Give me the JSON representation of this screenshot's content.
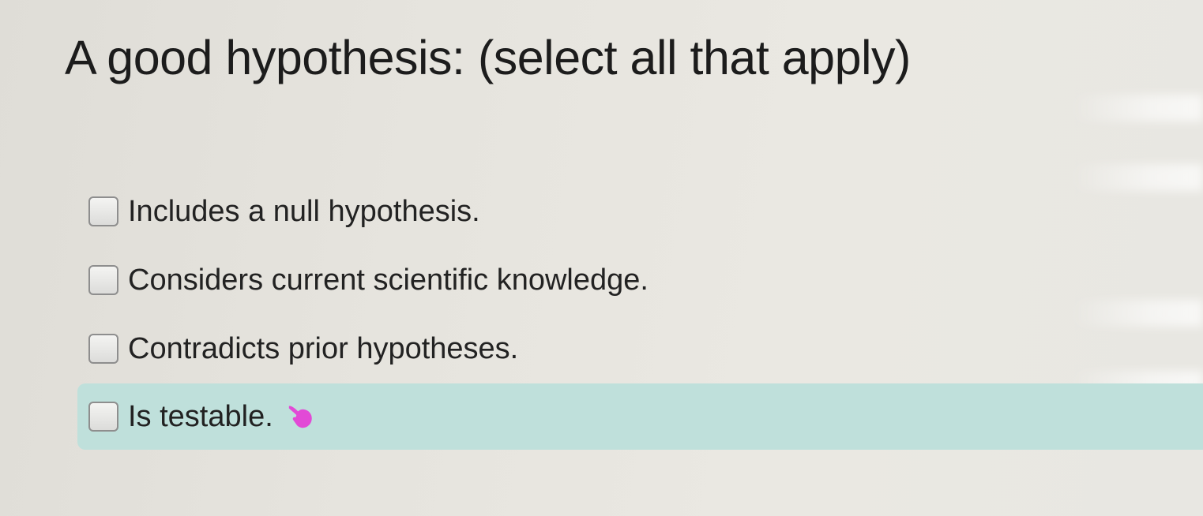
{
  "question": {
    "text": "A good hypothesis: (select all that apply)"
  },
  "options": [
    {
      "label": "Includes a null hypothesis.",
      "checked": false
    },
    {
      "label": "Considers current scientific knowledge.",
      "checked": false
    },
    {
      "label": "Contradicts prior hypotheses.",
      "checked": false
    },
    {
      "label": "Is testable.",
      "checked": false,
      "highlighted": true,
      "icon": "hand-pointer-icon"
    }
  ],
  "colors": {
    "highlight": "#bfe0db",
    "pointer": "#e24ad6"
  }
}
